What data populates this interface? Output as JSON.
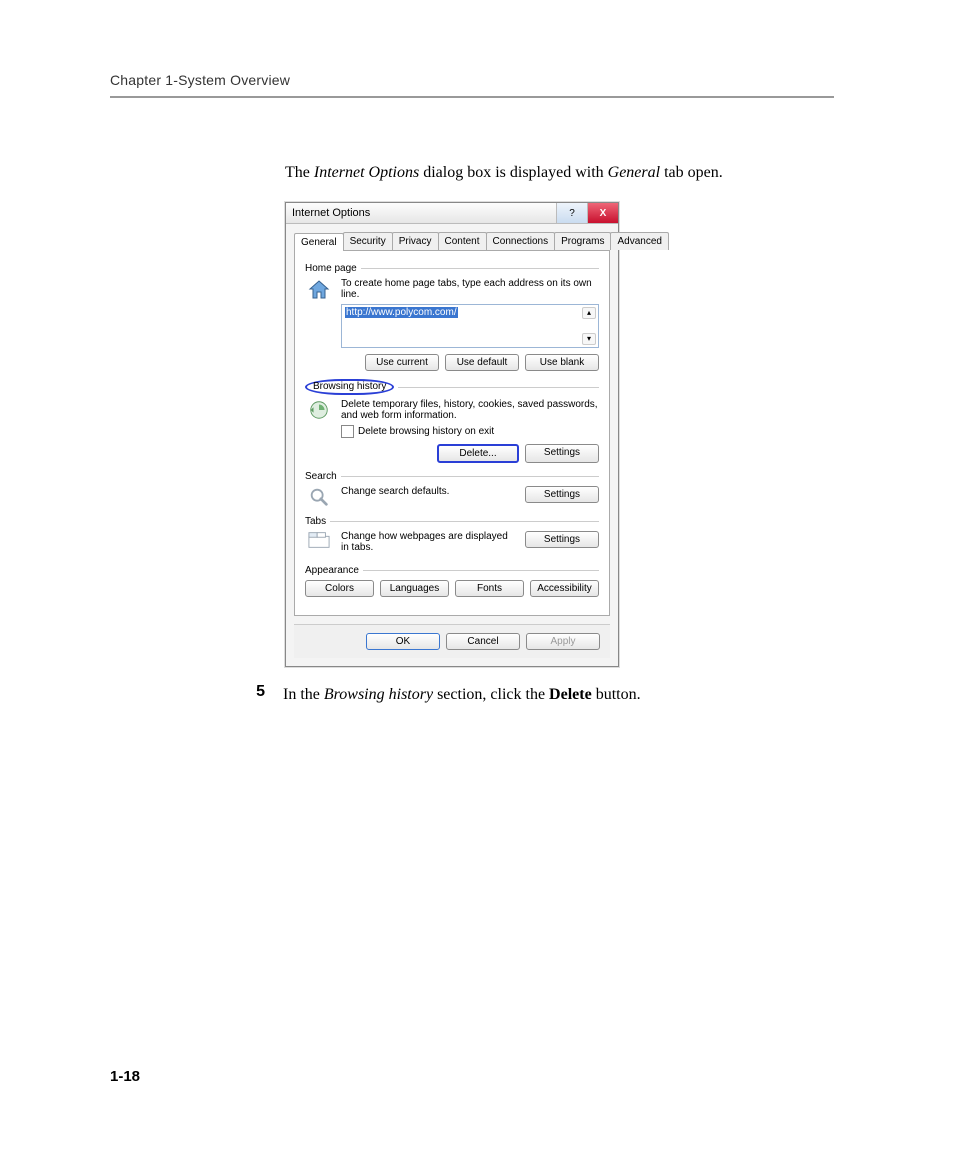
{
  "header": {
    "chapter": "Chapter 1-System Overview"
  },
  "intro": {
    "pre": "The ",
    "em1": "Internet Options",
    "mid": " dialog box is displayed with ",
    "em2": "General",
    "post": " tab open."
  },
  "dialog": {
    "title": "Internet Options",
    "help_glyph": "?",
    "close_glyph": "X",
    "tabs": [
      "General",
      "Security",
      "Privacy",
      "Content",
      "Connections",
      "Programs",
      "Advanced"
    ],
    "homepage": {
      "title": "Home page",
      "hint": "To create home page tabs, type each address on its own line.",
      "url": "http://www.polycom.com/",
      "use_current": "Use current",
      "use_default": "Use default",
      "use_blank": "Use blank"
    },
    "history": {
      "title": "Browsing history",
      "hint": "Delete temporary files, history, cookies, saved passwords, and web form information.",
      "chk_label": "Delete browsing history on exit",
      "delete": "Delete...",
      "settings": "Settings"
    },
    "search": {
      "title": "Search",
      "hint": "Change search defaults.",
      "settings": "Settings"
    },
    "tabs_section": {
      "title": "Tabs",
      "hint": "Change how webpages are displayed in tabs.",
      "settings": "Settings"
    },
    "appearance": {
      "title": "Appearance",
      "colors": "Colors",
      "languages": "Languages",
      "fonts": "Fonts",
      "accessibility": "Accessibility"
    },
    "footer": {
      "ok": "OK",
      "cancel": "Cancel",
      "apply": "Apply"
    }
  },
  "step": {
    "num": "5",
    "pre": "In the ",
    "em": "Browsing history",
    "mid": " section, click the ",
    "b": "Delete",
    "post": " button."
  },
  "page_number": "1-18"
}
